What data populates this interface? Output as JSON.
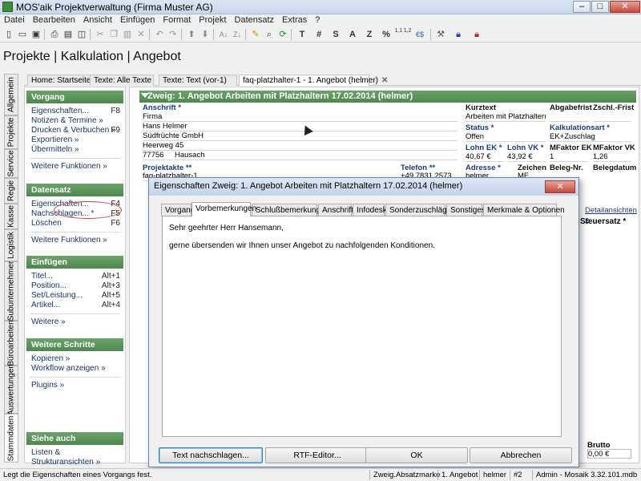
{
  "window": {
    "title": "MOS'aik Projektverwaltung (Firma Muster AG)",
    "min": "–",
    "max": "□",
    "close": "✕"
  },
  "menu": [
    "Datei",
    "Bearbeiten",
    "Ansicht",
    "Einfügen",
    "Format",
    "Projekt",
    "Datensatz",
    "Extras",
    "?"
  ],
  "toolbar": {
    "labels": [
      "T",
      "#",
      "S",
      "A",
      "Z",
      "%",
      "1,1 1,2",
      "€$"
    ],
    "icons": [
      "new-icon",
      "open-icon",
      "save-icon",
      "print-icon",
      "print-preview-icon",
      "zoom-icon",
      "cut-icon",
      "copy-icon",
      "paste-icon",
      "delete-icon",
      "undo-icon",
      "redo-icon",
      "arrow-up-icon",
      "arrow-down-icon",
      "sort-az-icon",
      "sort-za-icon",
      "pen-icon",
      "search-icon",
      "refresh-icon",
      "tools-icon",
      "lock-blue-icon",
      "lock-red-icon"
    ]
  },
  "page_title": "Projekte | Kalkulation | Angebot",
  "tabs": [
    {
      "label": "Home: Startseite"
    },
    {
      "label": "Texte: Alle Texte"
    },
    {
      "label": "Texte: Text (vor-1)"
    },
    {
      "label": "faq-platzhalter-1 - 1. Angebot (helmer)",
      "close": "✕"
    }
  ],
  "vtabs": [
    "Allgemein",
    "Projekte",
    "Service",
    "Regie",
    "Kasse",
    "Logistik",
    "Subunternehmer",
    "Büroarbeiten",
    "Auswertungen",
    "Stammdaten"
  ],
  "sidebar": {
    "groups": [
      {
        "title": "Vorgang",
        "items": [
          {
            "label": "Eigenschaften...",
            "key": "F8"
          },
          {
            "label": "Notizen & Termine »",
            "key": ""
          },
          {
            "label": "Drucken & Verbuchen »",
            "key": "F9"
          },
          {
            "label": "Exportieren »",
            "key": ""
          },
          {
            "label": "Übermitteln »",
            "key": ""
          }
        ],
        "more": "Weitere Funktionen »"
      },
      {
        "title": "Datensatz",
        "items": [
          {
            "label": "Eigenschaften...",
            "key": "F4"
          },
          {
            "label": "Nachschlagen... *",
            "key": "F5"
          },
          {
            "label": "Löschen",
            "key": "F6"
          }
        ],
        "more": "Weitere Funktionen »"
      },
      {
        "title": "Einfügen",
        "items": [
          {
            "label": "Titel...",
            "key": "Alt+1"
          },
          {
            "label": "Position...",
            "key": "Alt+3"
          },
          {
            "label": "Set/Leistung...",
            "key": "Alt+5"
          },
          {
            "label": "Artikel...",
            "key": "Alt+4"
          }
        ],
        "more": "Weitere »"
      },
      {
        "title": "Weitere Schritte",
        "items": [
          {
            "label": "Kopieren »",
            "key": ""
          },
          {
            "label": "Workflow anzeigen »",
            "key": ""
          }
        ],
        "more": "Plugins »"
      },
      {
        "title": "Siehe auch",
        "items": [
          {
            "label": "Listen & Strukturansichten »",
            "key": ""
          }
        ],
        "more": ""
      }
    ]
  },
  "zweig": {
    "header": "Zweig: 1. Angebot Arbeiten mit Platzhaltern 17.02.2014 (helmer)",
    "anschrift_label": "Anschrift *",
    "anschrift": [
      "Firma",
      "Hans Helmer",
      "Südfrüchte GmbH",
      "Heerweg 45"
    ],
    "plz": "77756",
    "ort": "Hausach",
    "kurztext_label": "Kurztext",
    "kurztext": "Arbeiten mit Platzhaltern",
    "abgabefrist_label": "Abgabefrist",
    "zschl_label": "Zschl.-Frist",
    "status_label": "Status *",
    "status": "Offen",
    "kalkart_label": "Kalkulationsart *",
    "kalkart": "EK+Zuschlag",
    "lohn_ek_label": "Lohn EK *",
    "lohn_ek": "40,67 €",
    "lohn_vk_label": "Lohn VK *",
    "lohn_vk": "43,92 €",
    "mfaktor_ek_label": "MFaktor EK",
    "mfaktor_ek": "1",
    "mfaktor_vk_label": "MFaktor VK",
    "mfaktor_vk": "1,26",
    "projektakte_label": "Projektakte **",
    "projektakte": "faq-platzhalter-1",
    "telefon_label": "Telefon **",
    "telefon": "+49 7831 2573",
    "adresse_label": "Adresse *",
    "adresse": "helmer",
    "zeichen_label": "Zeichen",
    "zeichen": "MF",
    "belegnr_label": "Beleg-Nr.",
    "belegdatum_label": "Belegdatum",
    "detailansichten": "Detailansichten »",
    "steuersatz": "Steuersatz *",
    "brutto_label": "Brutto",
    "brutto": "0,00 €"
  },
  "dialog": {
    "title": "Eigenschaften Zweig: 1. Angebot Arbeiten mit Platzhaltern 17.02.2014 (helmer)",
    "close": "✕",
    "tabs": [
      "Vorgang",
      "Vorbemerkungen",
      "Schlußbemerkungen",
      "Anschrift",
      "Infodesk",
      "Sonderzuschläge",
      "Sonstiges",
      "Merkmale & Optionen"
    ],
    "active_tab": "Vorbemerkungen",
    "text_lines": [
      "Sehr geehrter Herr Hansemann,",
      "gerne übersenden wir Ihnen unser Angebot zu nachfolgenden Konditionen."
    ],
    "buttons": {
      "lookup": "Text nachschlagen...",
      "rtf": "RTF-Editor...",
      "ok": "OK",
      "cancel": "Abbrechen"
    }
  },
  "status_bar": {
    "message": "Legt die Eigenschaften eines Vorgangs fest.",
    "fields": [
      "Zweig.Absatzmarke",
      "1. Angebot",
      "helmer",
      "#2",
      "Admin - Mosaik 3.32.101.mdb"
    ]
  }
}
